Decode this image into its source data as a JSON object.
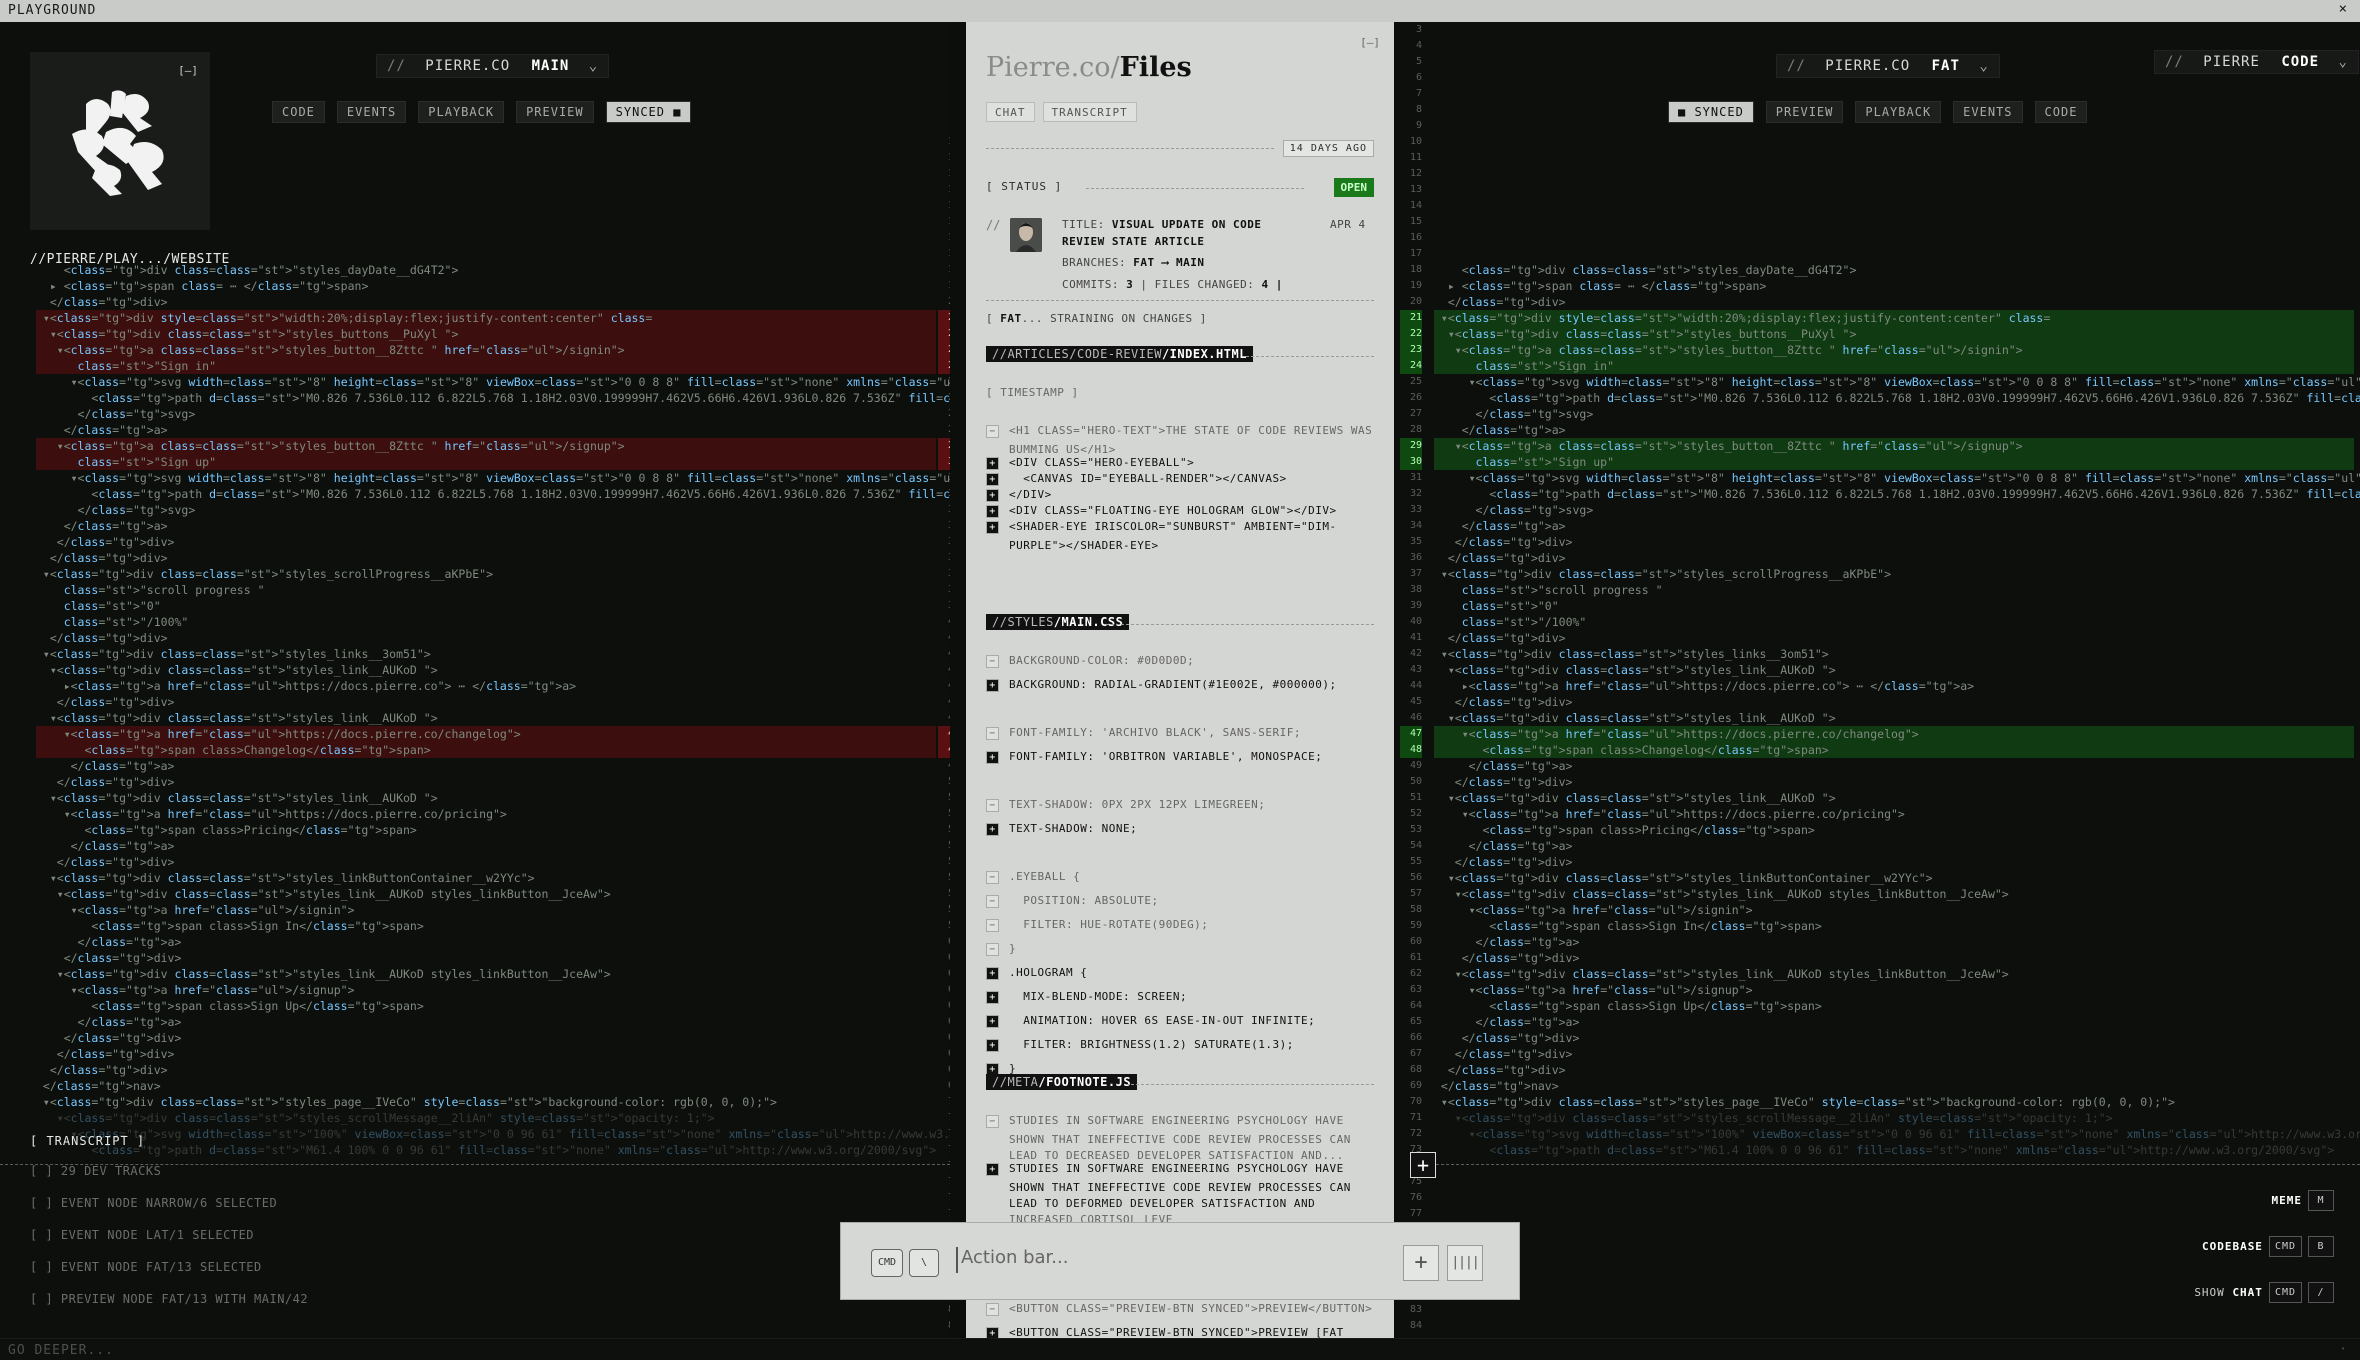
{
  "window": {
    "title": "PLAYGROUND",
    "close": "×"
  },
  "footer": {
    "label": "GO DEEPER...",
    "mark": "·"
  },
  "left": {
    "logo_min": "[–]",
    "branch": {
      "prefix": "//",
      "org": "PIERRE.CO",
      "name": "MAIN"
    },
    "tabs": [
      "CODE",
      "EVENTS",
      "PLAYBACK",
      "PREVIEW",
      "SYNCED ■"
    ],
    "breadcrumb": "//PIERRE/PLAY.../WEBSITE",
    "transcript_label": "[ TRANSCRIPT ]",
    "transcript_items": [
      "[ ] 29 DEV TRACKS",
      "[ ] EVENT NODE NARROW/6 SELECTED",
      "[ ] EVENT NODE LAT/1 SELECTED",
      "[ ] EVENT NODE FAT/13 SELECTED",
      "[ ] PREVIEW NODE FAT/13 WITH MAIN/42"
    ]
  },
  "code_lines": [
    {
      "n": "18",
      "t": "    <div class=\"styles_dayDate__dG4T2\">",
      "k": ""
    },
    {
      "n": "19",
      "t": "  ▸ <span class= ⋯ </span>",
      "k": ""
    },
    {
      "n": "20",
      "t": "  </div>",
      "k": ""
    },
    {
      "n": "21",
      "t": " ▾<div style=\"width:20%;display:flex;justify-content:center\" class=",
      "k": "d"
    },
    {
      "n": "22",
      "t": "  ▾<div class=\"styles_buttons__PuXyl \">",
      "k": "d"
    },
    {
      "n": "23",
      "t": "   ▾<a class=\"styles_button__8Zttc \" href=\"/signin\">",
      "k": "d"
    },
    {
      "n": "24",
      "t": "      \"Sign in\"",
      "k": "d"
    },
    {
      "n": "25",
      "t": "     ▾<svg width=\"8\" height=\"8\" viewBox=\"0 0 8 8\" fill=\"none\" xmlns=\"http://www.w3.org/2000/svg\">",
      "k": ""
    },
    {
      "n": "26",
      "t": "        <path d=\"M0.826 7.536L0.112 6.822L5.768 1.18H2.03V0.199999H7.462V5.66H6.426V1.936L0.826 7.536Z\" fill=\"inherit\"></path>",
      "k": ""
    },
    {
      "n": "27",
      "t": "      </svg>",
      "k": ""
    },
    {
      "n": "28",
      "t": "    </a>",
      "k": ""
    },
    {
      "n": "29",
      "t": "   ▾<a class=\"styles_button__8Zttc \" href=\"/signup\">",
      "k": "d"
    },
    {
      "n": "30",
      "t": "      \"Sign up\"",
      "k": "d"
    },
    {
      "n": "31",
      "t": "     ▾<svg width=\"8\" height=\"8\" viewBox=\"0 0 8 8\" fill=\"none\" xmlns=\"http://www.w3.org/2000/svg\">",
      "k": ""
    },
    {
      "n": "32",
      "t": "        <path d=\"M0.826 7.536L0.112 6.822L5.768 1.18H2.03V0.199999H7.462V5.66H6.426V1.936L0.826 7.536Z\" fill=\"inherit\"></path>",
      "k": ""
    },
    {
      "n": "33",
      "t": "      </svg>",
      "k": ""
    },
    {
      "n": "34",
      "t": "    </a>",
      "k": ""
    },
    {
      "n": "35",
      "t": "   </div>",
      "k": ""
    },
    {
      "n": "36",
      "t": "  </div>",
      "k": ""
    },
    {
      "n": "37",
      "t": " ▾<div class=\"styles_scrollProgress__aKPbE\">",
      "k": ""
    },
    {
      "n": "38",
      "t": "    \"scroll progress \"",
      "k": ""
    },
    {
      "n": "39",
      "t": "    \"0\"",
      "k": ""
    },
    {
      "n": "40",
      "t": "    \"/100%\"",
      "k": ""
    },
    {
      "n": "41",
      "t": "  </div>",
      "k": ""
    },
    {
      "n": "42",
      "t": " ▾<div class=\"styles_links__3om51\">",
      "k": ""
    },
    {
      "n": "43",
      "t": "  ▾<div class=\"styles_link__AUKoD \">",
      "k": ""
    },
    {
      "n": "44",
      "t": "    ▸<a href=\"https://docs.pierre.co\"> ⋯ </a>",
      "k": ""
    },
    {
      "n": "45",
      "t": "   </div>",
      "k": ""
    },
    {
      "n": "46",
      "t": "  ▾<div class=\"styles_link__AUKoD \">",
      "k": ""
    },
    {
      "n": "47",
      "t": "    ▾<a href=\"https://docs.pierre.co/changelog\">",
      "k": "d"
    },
    {
      "n": "48",
      "t": "       <span class>Changelog</span>",
      "k": "d"
    },
    {
      "n": "49",
      "t": "     </a>",
      "k": ""
    },
    {
      "n": "50",
      "t": "   </div>",
      "k": ""
    },
    {
      "n": "51",
      "t": "  ▾<div class=\"styles_link__AUKoD \">",
      "k": ""
    },
    {
      "n": "52",
      "t": "    ▾<a href=\"https://docs.pierre.co/pricing\">",
      "k": ""
    },
    {
      "n": "53",
      "t": "       <span class>Pricing</span>",
      "k": ""
    },
    {
      "n": "54",
      "t": "     </a>",
      "k": ""
    },
    {
      "n": "55",
      "t": "   </div>",
      "k": ""
    },
    {
      "n": "56",
      "t": "  ▾<div class=\"styles_linkButtonContainer__w2YYc\">",
      "k": ""
    },
    {
      "n": "57",
      "t": "   ▾<div class=\"styles_link__AUKoD styles_linkButton__JceAw\">",
      "k": ""
    },
    {
      "n": "58",
      "t": "     ▾<a href=\"/signin\">",
      "k": ""
    },
    {
      "n": "59",
      "t": "        <span class>Sign In</span>",
      "k": ""
    },
    {
      "n": "60",
      "t": "      </a>",
      "k": ""
    },
    {
      "n": "61",
      "t": "    </div>",
      "k": ""
    },
    {
      "n": "62",
      "t": "   ▾<div class=\"styles_link__AUKoD styles_linkButton__JceAw\">",
      "k": ""
    },
    {
      "n": "63",
      "t": "     ▾<a href=\"/signup\">",
      "k": ""
    },
    {
      "n": "64",
      "t": "        <span class>Sign Up</span>",
      "k": ""
    },
    {
      "n": "65",
      "t": "      </a>",
      "k": ""
    },
    {
      "n": "66",
      "t": "    </div>",
      "k": ""
    },
    {
      "n": "67",
      "t": "   </div>",
      "k": ""
    },
    {
      "n": "68",
      "t": "  </div>",
      "k": ""
    },
    {
      "n": "69",
      "t": " </nav>",
      "k": ""
    },
    {
      "n": "70",
      "t": " ▾<div class=\"styles_page__IVeCo\" style=\"background-color: rgb(0, 0, 0);\">",
      "k": ""
    },
    {
      "n": "71",
      "t": "   ▾<div class=\"styles_scrollMessage__2liAn\" style=\"opacity: 1;\">",
      "k": ""
    },
    {
      "n": "72",
      "t": "     ▾<svg width=\"100%\" viewBox=\"0 0 96 61\" fill=\"none\" xmlns=\"http://www.w3.org/2000/svg\">",
      "k": ""
    },
    {
      "n": "73",
      "t": "        <path d=\"M61.4 100% 0 0 96 61\" fill=\"none\" xmlns=\"http://www.w3.org/2000/svg\">",
      "k": ""
    }
  ],
  "center": {
    "title_light": "Pierre.co/",
    "title_bold": "Files",
    "min": "[–]",
    "tabs": [
      "CHAT",
      "TRANSCRIPT"
    ],
    "ago": "14 DAYS AGO",
    "status_label": "[ STATUS ]",
    "status_value": "OPEN",
    "title_k": "TITLE:",
    "title_v": "VISUAL UPDATE ON CODE REVIEW STATE ARTICLE",
    "date": "APR 4",
    "branches_k": "BRANCHES:",
    "branches_v": "FAT ⟶ MAIN",
    "commits_k": "COMMITS:",
    "commits_v": "3",
    "files_k": "| FILES CHANGED:",
    "files_v": "4 |",
    "fat_label": "FAT",
    "fat_rest": "... STRAINING ON CHANGES ]",
    "file1_path": "//ARTICLES/CODE-REVIEW",
    "file1_name": "/INDEX.HTML",
    "timestamp": "[ TIMESTAMP ]",
    "file1_lines": [
      {
        "s": "−",
        "t": "<H1 CLASS=\"HERO-TEXT\">THE STATE OF CODE REVIEWS WAS",
        "a": false
      },
      {
        "s": "",
        "t": "BUMMING US</H1>",
        "a": false
      },
      {
        "s": "+",
        "t": "<DIV CLASS=\"HERO-EYEBALL\">",
        "a": true
      },
      {
        "s": "+",
        "t": "  <CANVAS ID=\"EYEBALL-RENDER\"></CANVAS>",
        "a": true
      },
      {
        "s": "+",
        "t": "</DIV>",
        "a": true
      },
      {
        "s": "+",
        "t": "<DIV CLASS=\"FLOATING-EYE HOLOGRAM GLOW\"></DIV>",
        "a": true
      },
      {
        "s": "+",
        "t": "<SHADER-EYE IRISCOLOR=\"SUNBURST\" AMBIENT=\"DIM-",
        "a": true
      },
      {
        "s": "",
        "t": "PURPLE\"></SHADER-EYE>",
        "a": true
      }
    ],
    "file2_path": "//STYLES",
    "file2_name": "/MAIN.CSS",
    "file2_lines": [
      {
        "s": "−",
        "t": "BACKGROUND-COLOR: #0D0D0D;",
        "a": false
      },
      {
        "s": "+",
        "t": "BACKGROUND: RADIAL-GRADIENT(#1E002E, #000000);",
        "a": true
      },
      {
        "s": "",
        "t": "",
        "a": false
      },
      {
        "s": "−",
        "t": "FONT-FAMILY: 'ARCHIVO BLACK', SANS-SERIF;",
        "a": false
      },
      {
        "s": "+",
        "t": "FONT-FAMILY: 'ORBITRON VARIABLE', MONOSPACE;",
        "a": true
      },
      {
        "s": "",
        "t": "",
        "a": false
      },
      {
        "s": "−",
        "t": "TEXT-SHADOW: 0PX 2PX 12PX LIMEGREEN;",
        "a": false
      },
      {
        "s": "+",
        "t": "TEXT-SHADOW: NONE;",
        "a": true
      },
      {
        "s": "",
        "t": "",
        "a": false
      },
      {
        "s": "−",
        "t": ".EYEBALL {",
        "a": false
      },
      {
        "s": "−",
        "t": "  POSITION: ABSOLUTE;",
        "a": false
      },
      {
        "s": "−",
        "t": "  FILTER: HUE-ROTATE(90DEG);",
        "a": false
      },
      {
        "s": "−",
        "t": "}",
        "a": false
      },
      {
        "s": "+",
        "t": ".HOLOGRAM {",
        "a": true
      },
      {
        "s": "+",
        "t": "  MIX-BLEND-MODE: SCREEN;",
        "a": true
      },
      {
        "s": "+",
        "t": "  ANIMATION: HOVER 6S EASE-IN-OUT INFINITE;",
        "a": true
      },
      {
        "s": "+",
        "t": "  FILTER: BRIGHTNESS(1.2) SATURATE(1.3);",
        "a": true
      },
      {
        "s": "+",
        "t": "}",
        "a": true
      }
    ],
    "file3_path": "//META",
    "file3_name": "/FOOTNOTE.JS",
    "file3_lines": [
      {
        "s": "−",
        "t": "STUDIES IN SOFTWARE ENGINEERING PSYCHOLOGY HAVE",
        "a": false
      },
      {
        "s": "",
        "t": "SHOWN THAT INEFFECTIVE CODE REVIEW PROCESSES CAN",
        "a": false
      },
      {
        "s": "",
        "t": "LEAD TO DECREASED DEVELOPER SATISFACTION AND...",
        "a": false
      },
      {
        "s": "+",
        "t": "STUDIES IN SOFTWARE ENGINEERING PSYCHOLOGY HAVE",
        "a": true
      },
      {
        "s": "",
        "t": "SHOWN THAT INEFFECTIVE CODE REVIEW PROCESSES CAN",
        "a": true
      },
      {
        "s": "",
        "t": "LEAD TO DEFORMED DEVELOPER SATISFACTION AND",
        "a": true
      },
      {
        "s": "",
        "t": "INCREASED CORTISOL LEVE",
        "a": false
      }
    ],
    "file4_lines": [
      {
        "s": "−",
        "t": "<BUTTON CLASS=\"PREVIEW-BTN SYNCED\">PREVIEW</BUTTON>",
        "a": false
      },
      {
        "s": "+",
        "t": "<BUTTON CLASS=\"PREVIEW-BTN SYNCED\">PREVIEW [FAT",
        "a": true
      }
    ]
  },
  "right": {
    "branch": {
      "prefix": "//",
      "org": "PIERRE.CO",
      "name": "FAT"
    },
    "repo": {
      "prefix": "//",
      "org": "PIERRE",
      "name": "CODE"
    },
    "tabs": [
      "■ SYNCED",
      "PREVIEW",
      "PLAYBACK",
      "EVENTS",
      "CODE"
    ],
    "plus": "+",
    "shortcuts": [
      {
        "label": "MEME",
        "label2": "",
        "keys": [
          "M"
        ]
      },
      {
        "label": "CODEBASE",
        "label2": "",
        "keys": [
          "CMD",
          "B"
        ]
      },
      {
        "label": "SHOW ",
        "label2": "CHAT",
        "keys": [
          "CMD",
          "/"
        ]
      }
    ]
  },
  "action_bar": {
    "key1": "CMD",
    "key2": "\\",
    "placeholder": "Action bar...",
    "plus": "+",
    "voice": "||||"
  },
  "colors": {
    "deleted": "#3c0e0e",
    "added": "#0f3a12",
    "accent_green": "#1a7a1a"
  }
}
